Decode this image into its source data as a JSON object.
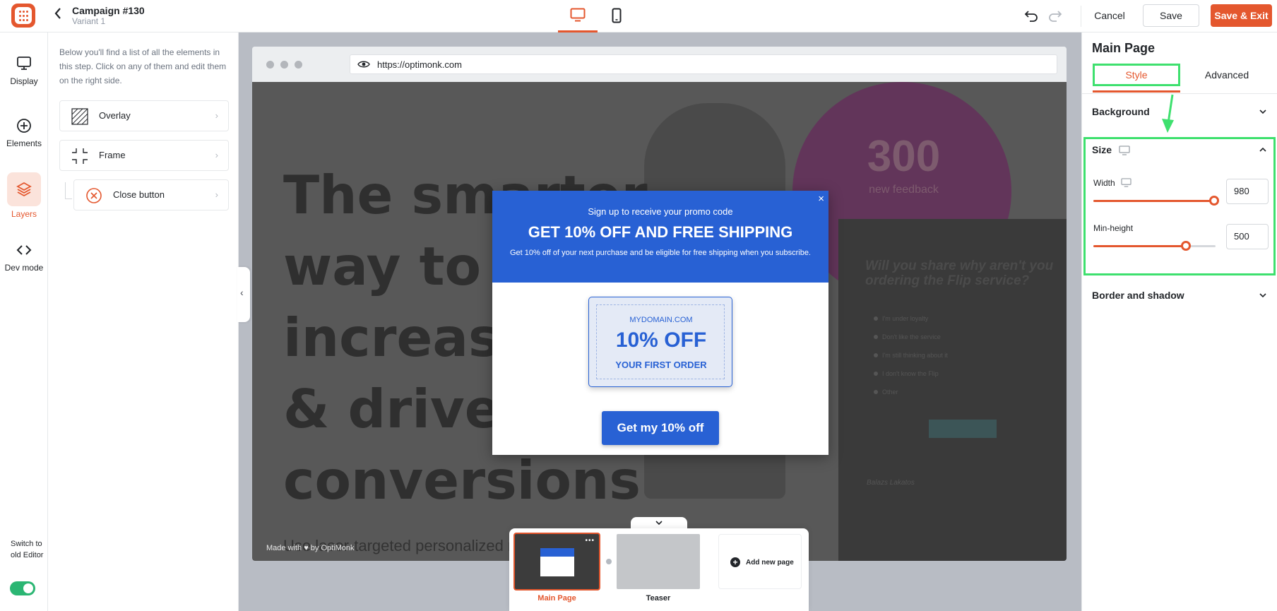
{
  "header": {
    "campaign_title": "Campaign #130",
    "variant": "Variant 1",
    "cancel_label": "Cancel",
    "save_label": "Save",
    "save_exit_label": "Save & Exit"
  },
  "left_rail": {
    "items": [
      {
        "label": "Display",
        "icon": "monitor-icon"
      },
      {
        "label": "Elements",
        "icon": "plus-circle-icon"
      },
      {
        "label": "Layers",
        "icon": "layers-icon",
        "active": true
      },
      {
        "label": "Dev mode",
        "icon": "code-icon"
      }
    ],
    "switch_label": "Switch to old Editor",
    "switch_on": true
  },
  "layers_panel": {
    "description": "Below you'll find a list of all the elements in this step. Click on any of them and edit them on the right side.",
    "items": [
      {
        "label": "Overlay",
        "icon": "overlay-icon"
      },
      {
        "label": "Frame",
        "icon": "frame-icon"
      },
      {
        "label": "Close button",
        "icon": "close-circle-icon"
      }
    ]
  },
  "browser": {
    "url": "https://optimonk.com"
  },
  "website": {
    "hero_lines": [
      "The smarter",
      "way to",
      "increase",
      "& drive",
      "conversions"
    ],
    "sub_text": "Use laser-targeted personalized me",
    "made_with": "Made with ♥ by OptiMonk",
    "stat_number": "300",
    "stat_label": "new feedback",
    "question": "Will you share why aren't you ordering the Flip service?",
    "options": [
      "I'm under loyalty",
      "Don't like the service",
      "I'm still thinking about it",
      "I don't know the Flip",
      "Other"
    ],
    "signature": "Balazs Lakatos"
  },
  "popup": {
    "kicker": "Sign up to receive your promo code",
    "headline": "GET 10% OFF AND FREE SHIPPING",
    "description": "Get 10% off of your next purchase and be eligible for free shipping when you subscribe.",
    "coupon_domain": "MYDOMAIN.COM",
    "coupon_off": "10% OFF",
    "coupon_first": "YOUR FIRST ORDER",
    "cta_label": "Get my 10% off",
    "close_glyph": "×"
  },
  "pages": {
    "main_label": "Main Page",
    "teaser_label": "Teaser",
    "add_label": "Add new page"
  },
  "right_panel": {
    "title": "Main Page",
    "tab_style": "Style",
    "tab_advanced": "Advanced",
    "background_label": "Background",
    "size_label": "Size",
    "width_label": "Width",
    "width_value": "980",
    "width_fraction": 0.99,
    "minheight_label": "Min-height",
    "minheight_value": "500",
    "minheight_fraction": 0.76,
    "border_label": "Border and shadow"
  },
  "colors": {
    "accent": "#e4572e",
    "popup_blue": "#2861d4",
    "highlight_green": "#3ee06e",
    "toggle_green": "#2bb673"
  }
}
